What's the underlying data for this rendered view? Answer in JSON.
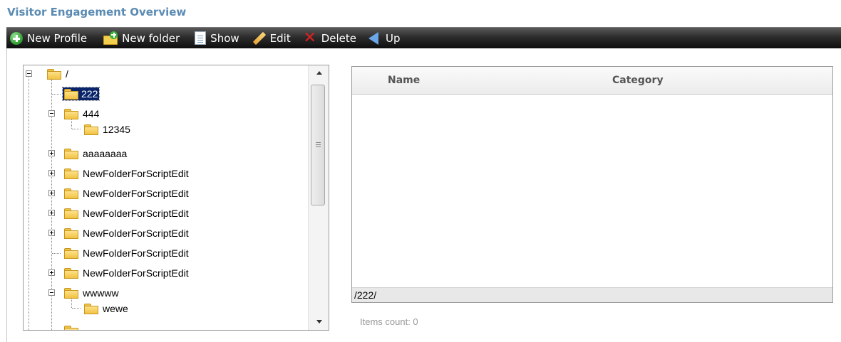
{
  "page": {
    "title": "Visitor Engagement Overview"
  },
  "toolbar": {
    "buttons": [
      {
        "label": "New Profile",
        "icon": "plus-circle-icon"
      },
      {
        "label": "New folder",
        "icon": "new-folder-icon"
      },
      {
        "label": "Show",
        "icon": "document-icon"
      },
      {
        "label": "Edit",
        "icon": "pencil-icon"
      },
      {
        "label": "Delete",
        "icon": "delete-x-icon"
      },
      {
        "label": "Up",
        "icon": "arrow-left-icon"
      }
    ]
  },
  "tree": {
    "nodes": [
      {
        "label": "/",
        "expander": "minus"
      },
      {
        "label": "222",
        "selected": true
      },
      {
        "label": "444",
        "expander": "minus"
      },
      {
        "label": "12345"
      },
      {
        "label": "aaaaaaaa",
        "expander": "plus"
      },
      {
        "label": "NewFolderForScriptEdit",
        "expander": "plus"
      },
      {
        "label": "NewFolderForScriptEdit",
        "expander": "plus"
      },
      {
        "label": "NewFolderForScriptEdit",
        "expander": "plus"
      },
      {
        "label": "NewFolderForScriptEdit",
        "expander": "plus"
      },
      {
        "label": "NewFolderForScriptEdit"
      },
      {
        "label": "NewFolderForScriptEdit",
        "expander": "plus"
      },
      {
        "label": "wwwww",
        "expander": "minus"
      },
      {
        "label": "wewe"
      }
    ]
  },
  "list": {
    "columns": [
      "Name",
      "Category"
    ],
    "path": "/222/",
    "items_count_label": "Items count: 0"
  },
  "colors": {
    "title": "#5b8bb3",
    "selection": "#0a246a",
    "folder": "#f1c243"
  }
}
